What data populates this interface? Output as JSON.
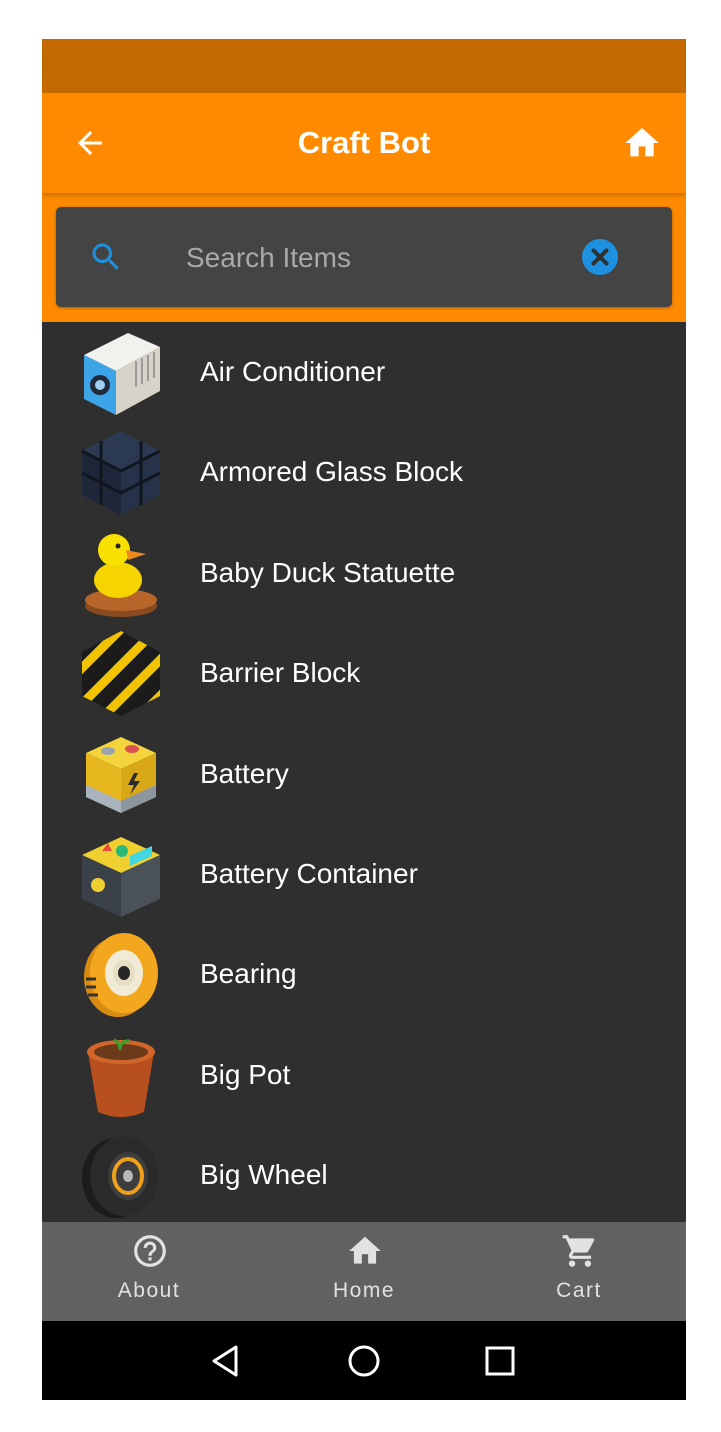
{
  "colors": {
    "accent": "#ff8a00",
    "status_bar": "#c26a00",
    "list_background": "#2f2f2f",
    "search_background": "#444444",
    "bottom_nav": "#616161",
    "search_icon": "#1e90e0",
    "clear_icon": "#1e90e0"
  },
  "app_bar": {
    "title": "Craft Bot",
    "back_icon": "arrow-left",
    "home_icon": "home"
  },
  "search": {
    "placeholder": "Search Items",
    "value": "",
    "search_icon": "search",
    "clear_icon": "close-circle"
  },
  "items": [
    {
      "label": "Air Conditioner",
      "icon": "air-conditioner"
    },
    {
      "label": "Armored Glass Block",
      "icon": "armored-glass-block"
    },
    {
      "label": "Baby Duck Statuette",
      "icon": "duck-statuette"
    },
    {
      "label": "Barrier Block",
      "icon": "barrier-block"
    },
    {
      "label": "Battery",
      "icon": "battery"
    },
    {
      "label": "Battery Container",
      "icon": "battery-container"
    },
    {
      "label": "Bearing",
      "icon": "bearing"
    },
    {
      "label": "Big Pot",
      "icon": "pot"
    },
    {
      "label": "Big Wheel",
      "icon": "wheel"
    }
  ],
  "bottom_nav": {
    "about": {
      "label": "About",
      "icon": "help-circle"
    },
    "home": {
      "label": "Home",
      "icon": "home"
    },
    "cart": {
      "label": "Cart",
      "icon": "cart"
    }
  },
  "system_nav": {
    "back_icon": "triangle-back",
    "home_icon": "circle-home",
    "recents_icon": "square-recents"
  }
}
